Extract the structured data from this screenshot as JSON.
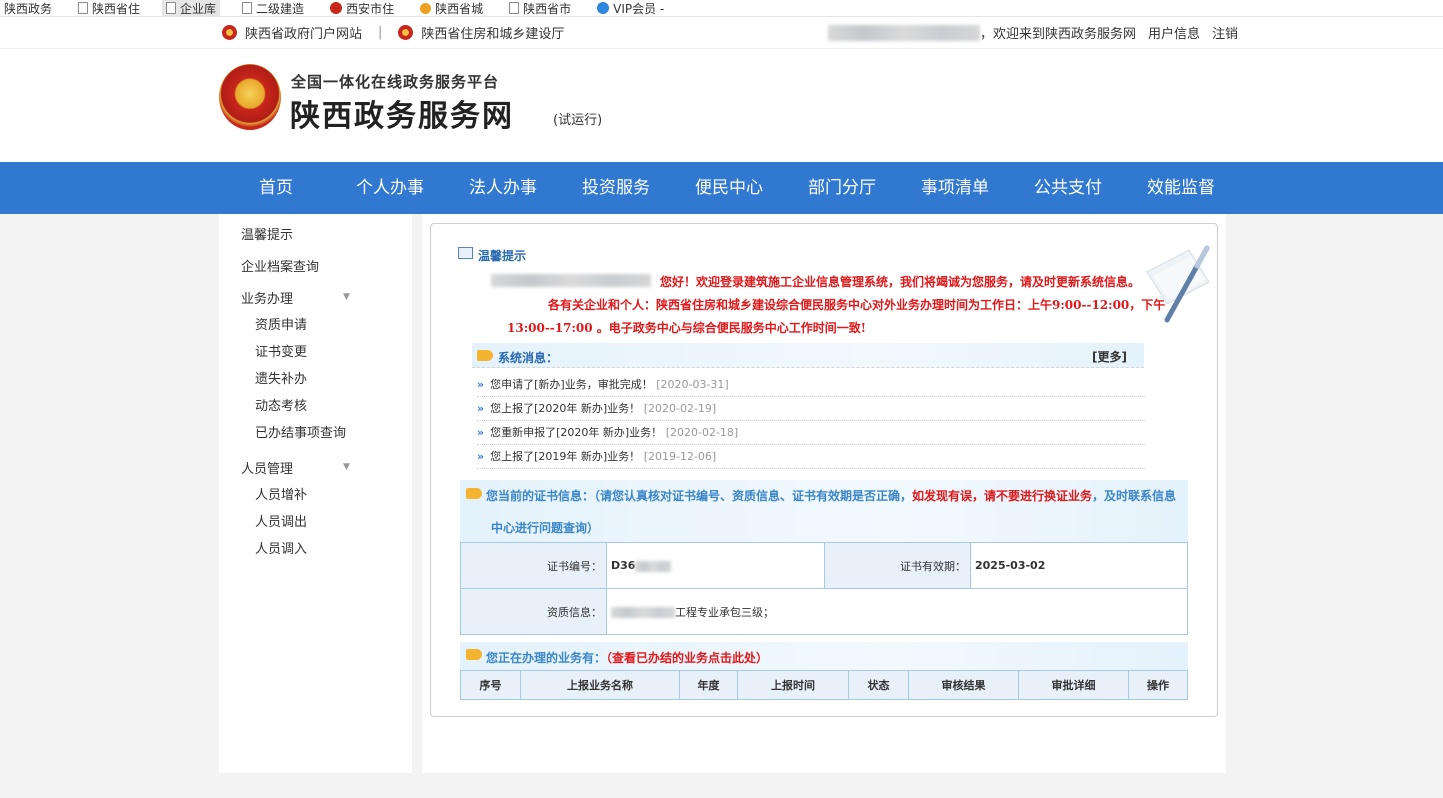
{
  "bookmarks": [
    "陕西政务",
    "陕西省住",
    "企业库",
    "二级建造",
    "西安市住",
    "陕西省城",
    "陕西省市",
    "VIP会员 -"
  ],
  "topbar": {
    "link1": "陕西省政府门户网站",
    "sep": "|",
    "link2": "陕西省住房和城乡建设厅",
    "welcome": "，欢迎来到陕西政务服务网",
    "user_info": "用户信息",
    "logout": "注销"
  },
  "header": {
    "subtitle": "全国一体化在线政务服务平台",
    "title": "陕西政务服务网",
    "trial": "(试运行)"
  },
  "nav": [
    "首页",
    "个人办事",
    "法人办事",
    "投资服务",
    "便民中心",
    "部门分厅",
    "事项清单",
    "公共支付",
    "效能监督"
  ],
  "sidebar": {
    "tips": "温馨提示",
    "archive": "企业档案查询",
    "business": "业务办理",
    "business_items": [
      "资质申请",
      "证书变更",
      "遗失补办",
      "动态考核",
      "已办结事项查询"
    ],
    "staff": "人员管理",
    "staff_items": [
      "人员增补",
      "人员调出",
      "人员调入"
    ]
  },
  "main": {
    "tips_title": "温馨提示",
    "welcome": "您好！欢迎登录建筑施工企业信息管理系统，我们将竭诚为您服务，请及时更新系统信息。",
    "notice_line1": "各有关企业和个人：陕西省住房和城乡建设综合便民服务中心对外业务办理时间为工作日：上午9:00--12:00，下午",
    "notice_line2": "13:00--17:00 。电子政务中心与综合便民服务中心工作时间一致!",
    "sys_title": "系统消息：",
    "more": "[更多]",
    "messages": [
      {
        "text": "您申请了[新办]业务，审批完成！",
        "date": "[2020-03-31]"
      },
      {
        "text": "您上报了[2020年 新办]业务！",
        "date": "[2020-02-19]"
      },
      {
        "text": "您重新申报了[2020年 新办]业务！",
        "date": "[2020-02-18]"
      },
      {
        "text": "您上报了[2019年 新办]业务！",
        "date": "[2019-12-06]"
      }
    ],
    "cert_prefix": "您当前的证书信息：（请您认真核对证书编号、资质信息、证书有效期是否正确，",
    "cert_red": "如发现有误，请不要进行换证业务",
    "cert_suffix": "，及时联系信息",
    "cert_line2": "中心进行问题查询）",
    "cert_no_label": "证书编号：",
    "cert_no": "D36",
    "cert_expiry_label": "证书有效期：",
    "cert_expiry": "2025-03-02",
    "qual_label": "资质信息：",
    "qual_value": "工程专业承包三级；",
    "busy_prefix": "您正在办理的业务有：",
    "busy_link": "（查看已办结的业务点击此处）",
    "biz_headers": [
      "序号",
      "上报业务名称",
      "年度",
      "上报时间",
      "状态",
      "审核结果",
      "审批详细",
      "操作"
    ]
  }
}
